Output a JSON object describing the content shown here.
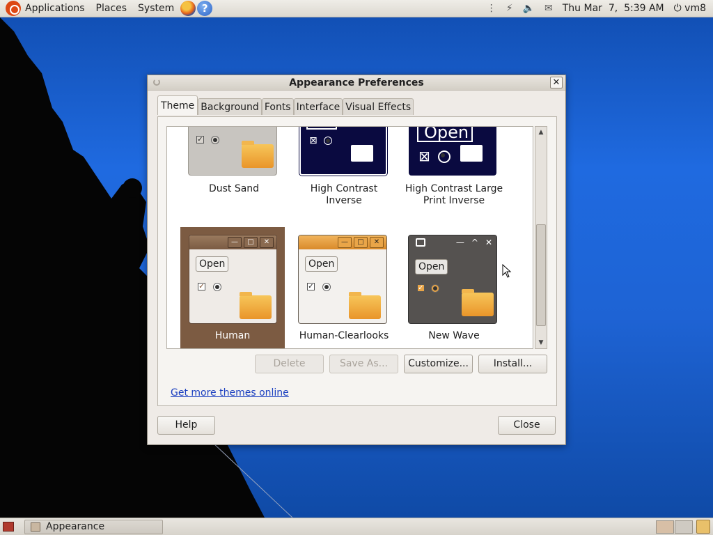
{
  "top_panel": {
    "menus": [
      "Applications",
      "Places",
      "System"
    ],
    "launchers": [
      "firefox-icon",
      "help-icon"
    ],
    "help_glyph": "?",
    "clock": "Thu Mar  7,  5:39 AM",
    "user": "vm8",
    "power_glyph": "⏻"
  },
  "window": {
    "title": "Appearance Preferences",
    "close_glyph": "✕",
    "tabs": [
      "Theme",
      "Background",
      "Fonts",
      "Interface",
      "Visual Effects"
    ],
    "active_tab": "Theme",
    "themes": [
      {
        "name": "Dust Sand"
      },
      {
        "name": "High Contrast Inverse"
      },
      {
        "name": "High Contrast Large Print Inverse"
      },
      {
        "name": "Human",
        "selected": true
      },
      {
        "name": "Human-Clearlooks"
      },
      {
        "name": "New Wave"
      }
    ],
    "thumb_open_label": "Open",
    "thumb_glyphs": {
      "check": "✓",
      "x_box": "⊠",
      "min": "—",
      "max": "□",
      "close": "✕",
      "up": "^"
    },
    "scroll_up": "▲",
    "scroll_down": "▼",
    "buttons": {
      "delete": "Delete",
      "save_as": "Save As...",
      "customize": "Customize...",
      "install": "Install..."
    },
    "link": "Get more themes online",
    "help": "Help",
    "close": "Close"
  },
  "bottom_panel": {
    "task": "Appearance Preferences"
  },
  "colors": {
    "selection": "#7c5b42",
    "desktop_blue": "#1f6ae0",
    "link": "#1b3fc0"
  }
}
